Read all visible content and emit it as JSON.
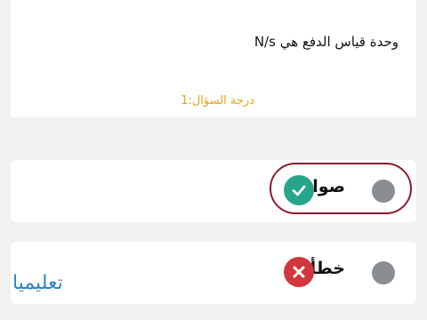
{
  "question": {
    "text": "وحدة قياس الدفع هي N/s",
    "grade": "درجة السؤال:1"
  },
  "options": [
    {
      "label": "صواب",
      "status_icon": "check-icon",
      "selected": true,
      "color": "#27a48c"
    },
    {
      "label": "خطأ",
      "status_icon": "cross-icon",
      "selected": false,
      "color": "#d1373c"
    }
  ],
  "footer": {
    "instructions_label": "تعليميا"
  },
  "colors": {
    "accent_grade": "#e8a31c",
    "highlight_ring": "#8b1d2c",
    "link": "#2e84c6",
    "radio": "#8a8d92"
  }
}
